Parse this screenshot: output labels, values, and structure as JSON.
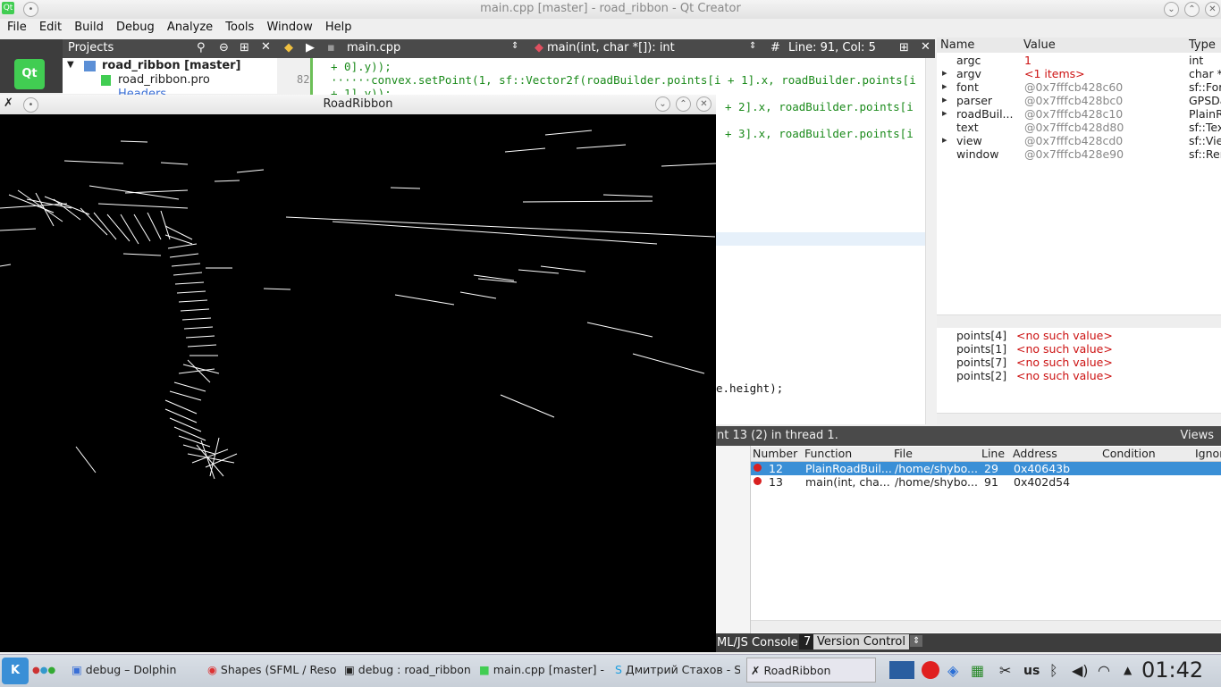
{
  "window": {
    "title": "main.cpp [master] - road_ribbon - Qt Creator"
  },
  "menu": [
    "File",
    "Edit",
    "Build",
    "Debug",
    "Analyze",
    "Tools",
    "Window",
    "Help"
  ],
  "projects": {
    "header": "Projects",
    "root": "road_ribbon [master]",
    "pro_file": "road_ribbon.pro",
    "headers": "Headers"
  },
  "editor": {
    "file": "main.cpp",
    "function": "main(int, char *[]): int",
    "position": "Line: 91, Col: 5",
    "line_number": "82",
    "lines": [
      "+ 0].y));",
      "······convex.setPoint(1, sf::Vector2f(roadBuilder.points[i + 1].x, roadBuilder.points[i",
      "+ 1].y));",
      "+ 2].x, roadBuilder.points[i",
      "+ 3].x, roadBuilder.points[i",
      "e.height);"
    ]
  },
  "locals": {
    "headers": [
      "Name",
      "Value",
      "Type"
    ],
    "rows": [
      {
        "name": "argc",
        "value": "1",
        "type": "int",
        "expand": ""
      },
      {
        "name": "argv",
        "value": "<1 items>",
        "type": "char *",
        "expand": "▸"
      },
      {
        "name": "font",
        "value": "@0x7fffcb428c60",
        "type": "sf::For",
        "expand": "▸"
      },
      {
        "name": "parser",
        "value": "@0x7fffcb428bc0",
        "type": "GPSDa",
        "expand": "▸"
      },
      {
        "name": "roadBuil...",
        "value": "@0x7fffcb428c10",
        "type": "PlainR",
        "expand": "▸"
      },
      {
        "name": "text",
        "value": "@0x7fffcb428d80",
        "type": "sf::Tex",
        "expand": ""
      },
      {
        "name": "view",
        "value": "@0x7fffcb428cd0",
        "type": "sf::Vie",
        "expand": "▸"
      },
      {
        "name": "window",
        "value": "@0x7fffcb428e90",
        "type": "sf::Rer",
        "expand": ""
      }
    ]
  },
  "watches": [
    {
      "name": "points[4]",
      "value": "<no such value>"
    },
    {
      "name": "points[1]",
      "value": "<no such value>"
    },
    {
      "name": "points[7]",
      "value": "<no such value>"
    },
    {
      "name": "points[2]",
      "value": "<no such value>"
    }
  ],
  "breakpoints": {
    "status": "nt 13 (2) in thread 1.",
    "views": "Views",
    "headers": [
      "Number",
      "Function",
      "File",
      "Line",
      "Address",
      "Condition",
      "Ignore"
    ],
    "rows": [
      {
        "number": "12",
        "function": "PlainRoadBuil...",
        "file": "/home/shybo...",
        "line": "29",
        "address": "0x40643b"
      },
      {
        "number": "13",
        "function": "main(int, cha...",
        "file": "/home/shybo...",
        "line": "91",
        "address": "0x402d54"
      }
    ]
  },
  "bottom_tabs": {
    "console": "ML/JS Console",
    "vc_num": "7",
    "vc": "Version Control"
  },
  "roadribbon": {
    "title": "RoadRibbon"
  },
  "taskbar": {
    "items": [
      "debug – Dolphin",
      "Shapes (SFML / Reso",
      "debug : road_ribbon",
      "main.cpp [master] - r",
      "Дмитрий Стахов - Sk",
      "RoadRibbon"
    ],
    "lang": "us",
    "clock": "01:42"
  },
  "colors": {
    "accent": "#3a8fd6",
    "code_green": "#1a8a1a",
    "error_red": "#cc1111"
  }
}
